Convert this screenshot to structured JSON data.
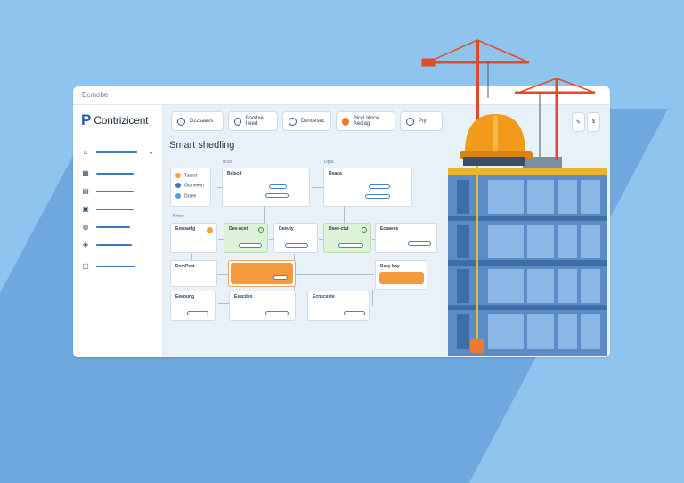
{
  "window": {
    "title": "Ecmobe"
  },
  "app": {
    "logo_mark": "P",
    "logo_text": "Contrizicent"
  },
  "toolbar": {
    "items": [
      {
        "label": "Dzzsaaes",
        "icon": "gauge-icon"
      },
      {
        "label": "Bsndxe Ifeed",
        "icon": "calendar-icon"
      },
      {
        "label": "Dsnoesec",
        "icon": "people-icon"
      },
      {
        "label": "Biccl Iitnce Aeclag",
        "icon": "alert-icon"
      },
      {
        "label": "Pty",
        "icon": "chart-icon"
      }
    ],
    "controls": [
      "edit-icon",
      "currency-icon"
    ]
  },
  "main": {
    "title": "Smart shedling",
    "section_labels": [
      "Bcoc",
      "Dpta",
      "Bmns"
    ],
    "legend": [
      "Tasoct",
      "Gtaneeon",
      "Drsee"
    ],
    "cards": [
      {
        "id": "c1",
        "title": "Bslscd",
        "sub": ""
      },
      {
        "id": "c2",
        "title": "Dsaca",
        "sub": ""
      },
      {
        "id": "c3",
        "title": "Eseoanlg",
        "sub": ""
      },
      {
        "id": "c4",
        "title": "Dee-ocet",
        "sub": ""
      },
      {
        "id": "c5",
        "title": "Deeuty",
        "sub": ""
      },
      {
        "id": "c6",
        "title": "Dsee-ctat",
        "sub": ""
      },
      {
        "id": "c7",
        "title": "Ecnaees",
        "sub": ""
      },
      {
        "id": "c8",
        "title": "DemPeat",
        "sub": ""
      },
      {
        "id": "c9",
        "title": "Dazy bay",
        "sub": ""
      },
      {
        "id": "c10",
        "title": "Eeeoung",
        "sub": ""
      },
      {
        "id": "c11",
        "title": "Esecdeo",
        "sub": ""
      },
      {
        "id": "c12",
        "title": "Ecnsceste",
        "sub": ""
      }
    ]
  },
  "colors": {
    "background": "#8fc4ee",
    "accent": "#3d76bf",
    "orange": "#f59a3c",
    "green": "#dcf3d8",
    "crane": "#e14a2a",
    "helmet": "#f29a1a",
    "building": "#5b8cc8"
  }
}
